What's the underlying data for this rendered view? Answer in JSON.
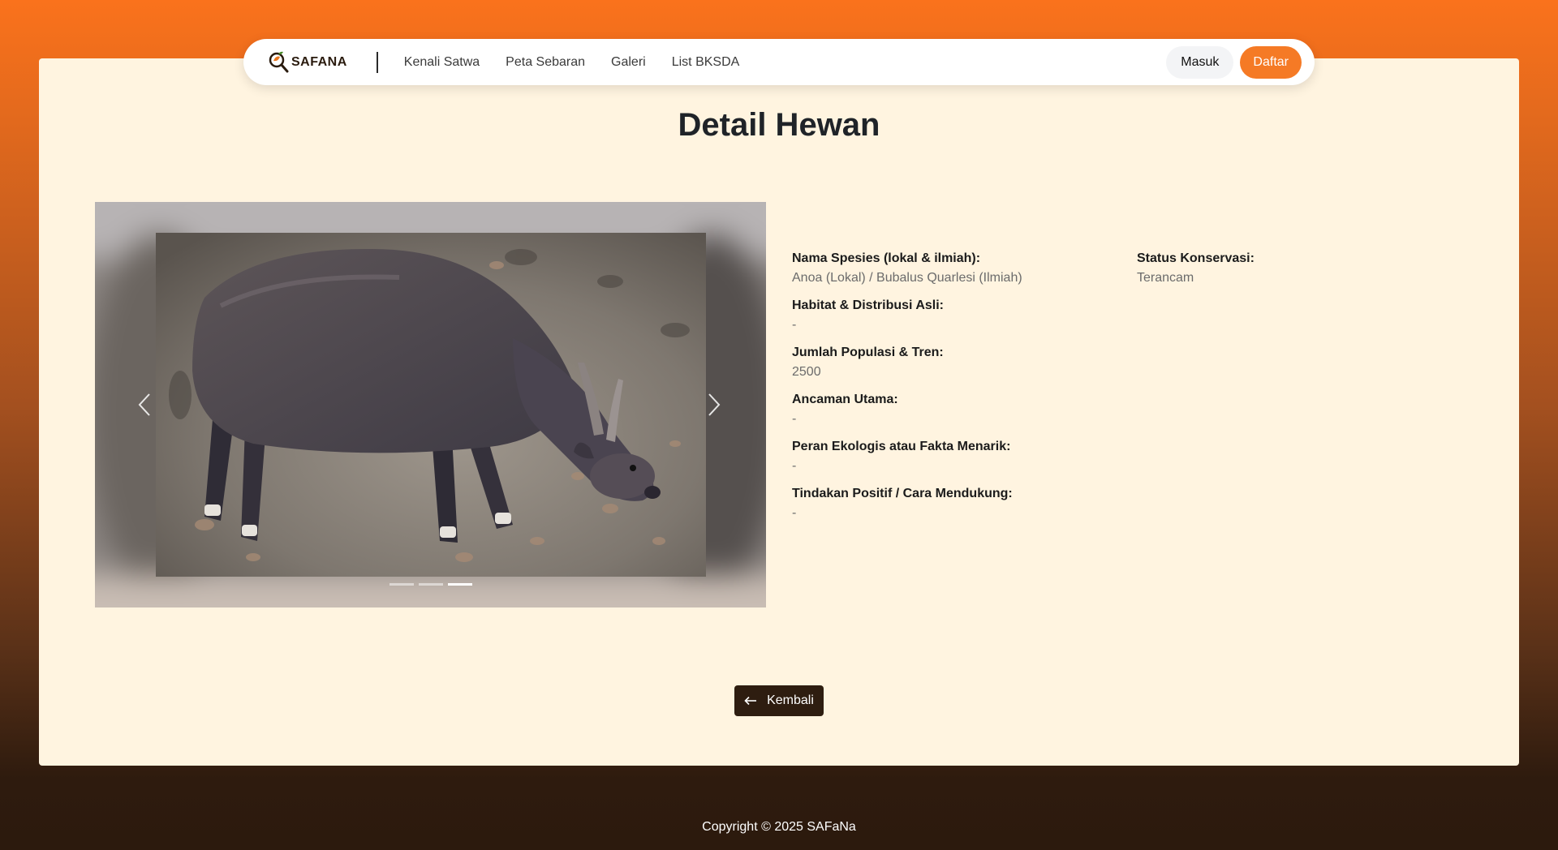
{
  "nav": {
    "brand": "SAFANA",
    "links": [
      "Kenali Satwa",
      "Peta Sebaran",
      "Galeri",
      "List BKSDA"
    ],
    "login_label": "Masuk",
    "register_label": "Daftar"
  },
  "page": {
    "title": "Detail Hewan"
  },
  "carousel": {
    "slide_count": 3,
    "active_index": 2
  },
  "details": {
    "species": {
      "label": "Nama Spesies (lokal & ilmiah):",
      "value": "Anoa (Lokal) / Bubalus Quarlesi (Ilmiah)"
    },
    "habitat": {
      "label": "Habitat & Distribusi Asli:",
      "value": "-"
    },
    "population": {
      "label": "Jumlah Populasi & Tren:",
      "value": "2500"
    },
    "threats": {
      "label": "Ancaman Utama:",
      "value": "-"
    },
    "ecology": {
      "label": "Peran Ekologis atau Fakta Menarik:",
      "value": "-"
    },
    "actions": {
      "label": "Tindakan Positif / Cara Mendukung:",
      "value": "-"
    },
    "conservation": {
      "label": "Status Konservasi:",
      "value": "Terancam"
    }
  },
  "back_label": "Kembali",
  "footer": {
    "copyright": "Copyright © 2025 SAFaNa"
  },
  "colors": {
    "brand_orange": "#f57a25",
    "dark_brown": "#2e1d10",
    "panel_cream": "#fff4e0"
  }
}
